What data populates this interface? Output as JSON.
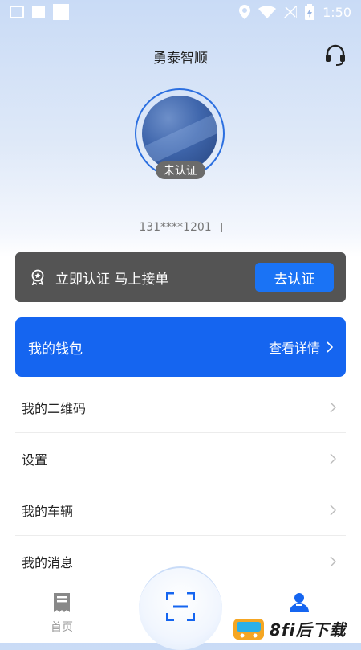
{
  "status_bar": {
    "time": "1:50"
  },
  "header": {
    "title": "勇泰智顺"
  },
  "profile": {
    "cert_status": "未认证",
    "phone": "131****1201"
  },
  "verify_card": {
    "text": "立即认证 马上接单",
    "button_label": "去认证"
  },
  "wallet": {
    "title": "我的钱包",
    "detail_label": "查看详情"
  },
  "menu": {
    "items": [
      {
        "label": "我的二维码"
      },
      {
        "label": "设置"
      },
      {
        "label": "我的车辆"
      },
      {
        "label": "我的消息"
      }
    ]
  },
  "tabbar": {
    "home_label": "首页"
  },
  "watermark": {
    "text": "8fi后下载"
  },
  "colors": {
    "accent": "#1565f0",
    "verify_bg": "#545454",
    "badge_bg": "#6b6b6b"
  },
  "icons": [
    "image-icon",
    "location-icon",
    "wifi-icon",
    "battery-icon",
    "headset-icon",
    "award-icon",
    "chevron-right-icon",
    "home-doc-icon",
    "scan-icon",
    "user-icon"
  ]
}
